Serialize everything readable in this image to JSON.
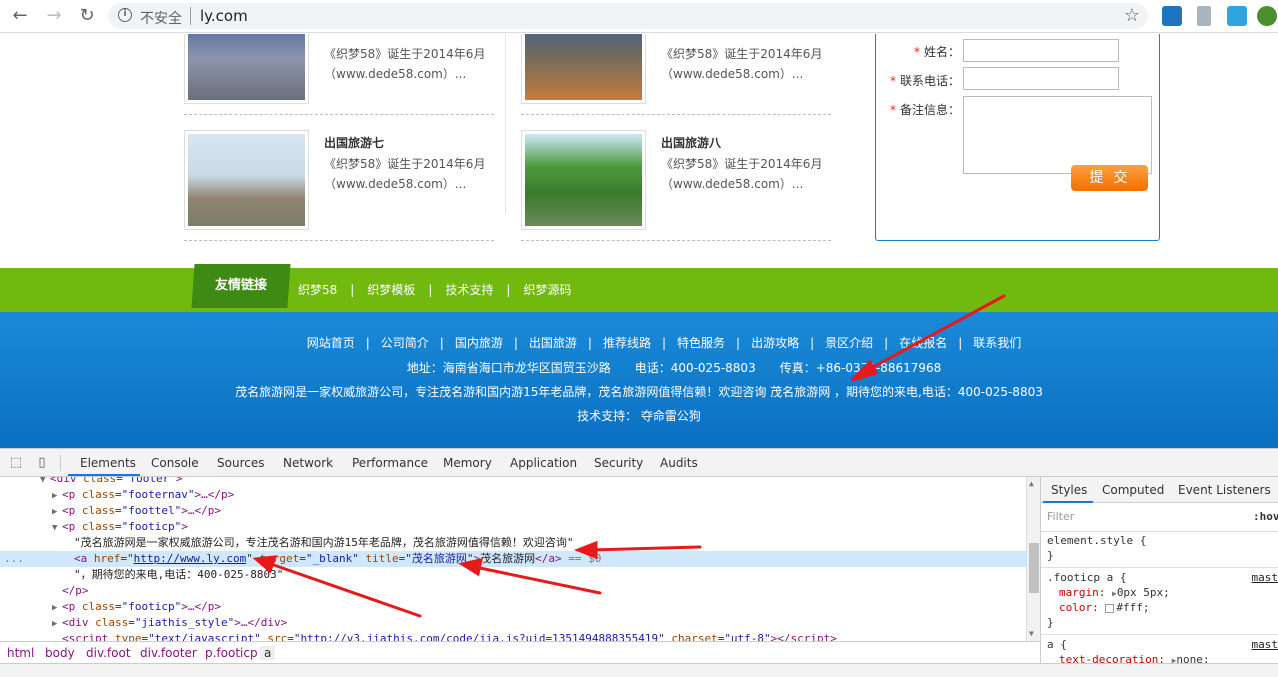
{
  "browser": {
    "back": "←",
    "forward": "→",
    "reload": "↻",
    "insecure_label": "不安全",
    "url": "ly.com",
    "star": "☆"
  },
  "articles": [
    {
      "title": "",
      "line1": "《织梦58》诞生于2014年6月",
      "line2": "（www.dede58.com）...",
      "img_colors": [
        "#1e3a7a",
        "#9aa3b5",
        "#5b6272"
      ]
    },
    {
      "title": "",
      "line1": "《织梦58》诞生于2014年6月",
      "line2": "（www.dede58.com）...",
      "img_colors": [
        "#1e4a9c",
        "#7a6a52",
        "#d08a3a"
      ]
    },
    {
      "title": "出国旅游七",
      "line1": "《织梦58》诞生于2014年6月",
      "line2": "（www.dede58.com）...",
      "img_colors": [
        "#cfe0ee",
        "#9a8e74",
        "#7b7d6a"
      ]
    },
    {
      "title": "出国旅游八",
      "line1": "《织梦58》诞生于2014年6月",
      "line2": "（www.dede58.com）...",
      "img_colors": [
        "#c9e6f7",
        "#3d8a3a",
        "#557a3c"
      ]
    }
  ],
  "form": {
    "name_label": "姓名：",
    "phone_label": "联系电话：",
    "note_label": "备注信息：",
    "required_mark": "*",
    "submit": "提交"
  },
  "links": {
    "tab": "友情链接",
    "items": [
      "织梦58",
      "织梦模板",
      "技术支持",
      "织梦源码"
    ],
    "separator": "|"
  },
  "footer": {
    "nav": [
      "网站首页",
      "公司简介",
      "国内旅游",
      "出国旅游",
      "推荐线路",
      "特色服务",
      "出游攻略",
      "景区介绍",
      "在线报名",
      "联系我们"
    ],
    "separator": "|",
    "address_line": "地址：海南省海口市龙华区国贸玉沙路　　电话：400-025-8803　　传真：+86-0371-88617968",
    "intro_line": "茂名旅游网是一家权威旅游公司，专注茂名游和国内游15年老品牌，茂名旅游网值得信赖！欢迎咨询 茂名旅游网 ，期待您的来电,电话：400-025-8803",
    "support_line": "技术支持： 夺命雷公狗"
  },
  "devtools": {
    "tabs": [
      "Elements",
      "Console",
      "Sources",
      "Network",
      "Performance",
      "Memory",
      "Application",
      "Security",
      "Audits"
    ],
    "dom": {
      "l0_tag": "div",
      "l0_attr": "class",
      "l0_val": "\"footer\"",
      "l1_val": "\"footernav\"",
      "l1_rest": "…</p>",
      "l2_val": "\"foottel\"",
      "l2_rest": "…</p>",
      "l3_val": "\"footicp\"",
      "l4_text": "\"茂名旅游网是一家权威旅游公司，专注茂名游和国内游15年老品牌，茂名旅游网值得信赖！欢迎咨询\"",
      "l5_href": "http://www.ly.com",
      "l5_target": "\"_blank\"",
      "l5_title": "\"茂名旅游网\"",
      "l5_text": "茂名旅游网",
      "l5_eq": "== $0",
      "l6_text": "\"，期待您的来电,电话：400-025-8803\"",
      "l7_close": "</p>",
      "l8_val": "\"footicp\"",
      "l8_rest": "…</p>",
      "l9_val": "\"jiathis_style\"",
      "l9_rest": "…</div>",
      "l10_src": "\"http://v3.jiathis.com/code/jia.js?uid=1351494888355419\"",
      "l10_charset": "\"utf-8\"",
      "ellipsis": "..."
    },
    "breadcrumbs": [
      "html",
      "body",
      "div.foot",
      "div.footer",
      "p.footicp",
      "a"
    ],
    "styles": {
      "tabs": [
        "Styles",
        "Computed",
        "Event Listeners"
      ],
      "filter_placeholder": "Filter",
      "hov": ":hov",
      "element_style": "element.style {",
      "close_brace": "}",
      "rule1_selector": ".footicp a {",
      "rule1_src": "mast",
      "rule1_margin_prop": "margin:",
      "rule1_margin_val": "0px 5px;",
      "rule1_color_prop": "color:",
      "rule1_color_val": "#fff;",
      "rule2_selector": "a {",
      "rule2_src": "mast",
      "rule2_prop": "text-decoration:",
      "rule2_val": "none;"
    }
  },
  "colors": {
    "green_bar": "#72b90f",
    "footer_blue": "#1a8ad8",
    "form_border": "#1d7ec7",
    "submit_orange": "#f58a1f",
    "annotation_red": "#e8191a"
  }
}
